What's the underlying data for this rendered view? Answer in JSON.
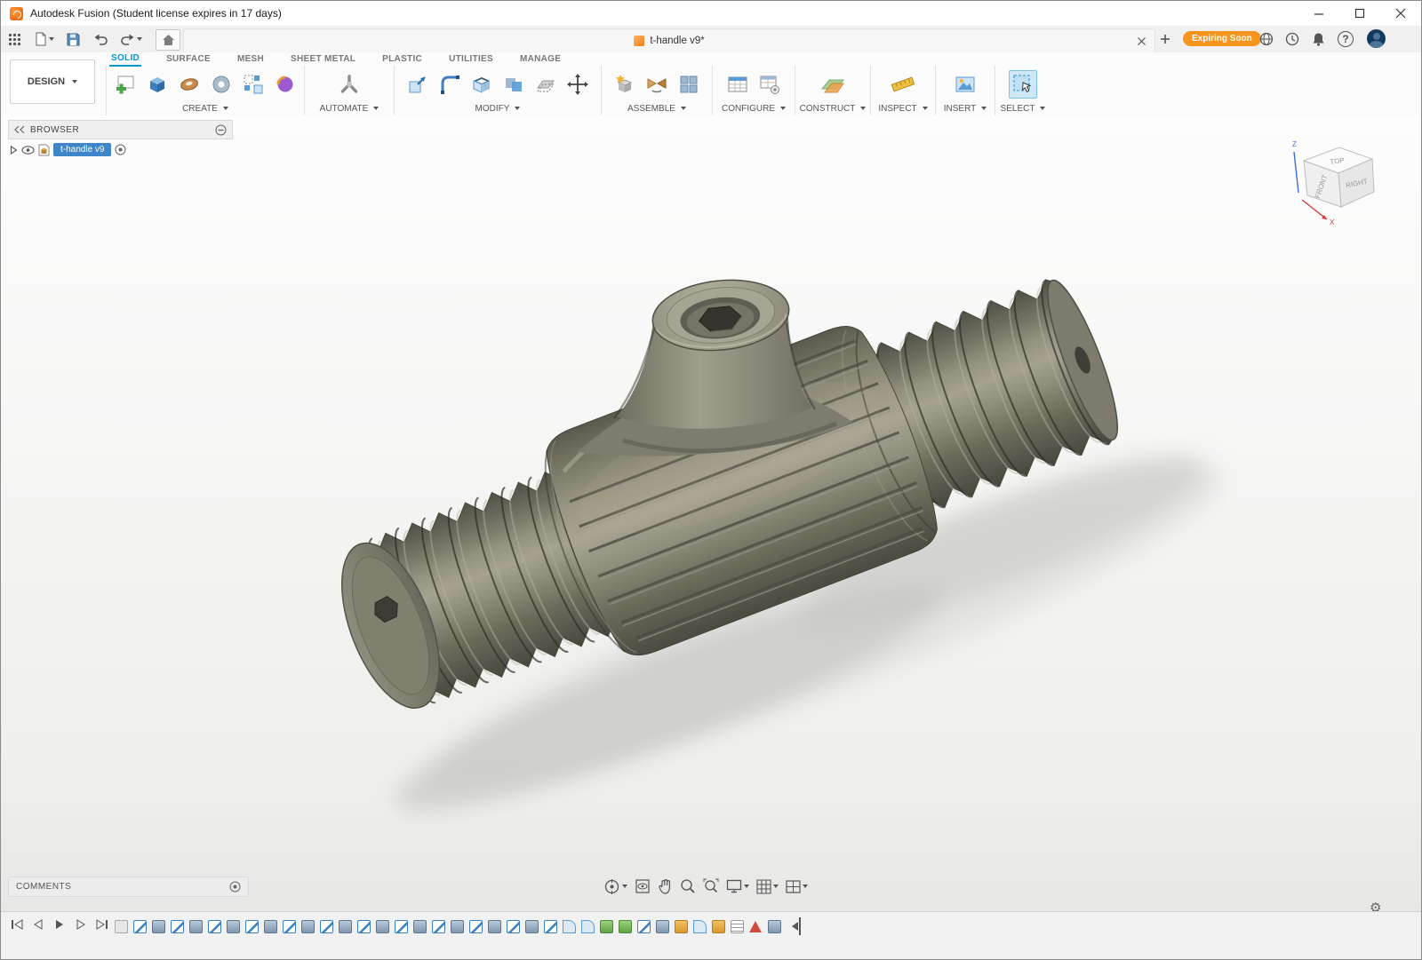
{
  "window": {
    "title": "Autodesk Fusion (Student license expires in 17 days)"
  },
  "tab_bar": {
    "document_title": "t-handle v9*",
    "expiring_badge": "Expiring Soon"
  },
  "ribbon": {
    "workspace": "DESIGN",
    "tabs": [
      {
        "label": "SOLID",
        "active": true
      },
      {
        "label": "SURFACE"
      },
      {
        "label": "MESH"
      },
      {
        "label": "SHEET METAL"
      },
      {
        "label": "PLASTIC"
      },
      {
        "label": "UTILITIES"
      },
      {
        "label": "MANAGE"
      }
    ],
    "groups": [
      {
        "label": "CREATE"
      },
      {
        "label": "AUTOMATE"
      },
      {
        "label": "MODIFY"
      },
      {
        "label": "ASSEMBLE"
      },
      {
        "label": "CONFIGURE"
      },
      {
        "label": "CONSTRUCT"
      },
      {
        "label": "INSPECT"
      },
      {
        "label": "INSERT"
      },
      {
        "label": "SELECT"
      }
    ]
  },
  "browser": {
    "title": "BROWSER",
    "items": [
      {
        "label": "t-handle v9",
        "selected": true
      }
    ]
  },
  "viewcube": {
    "top": "TOP",
    "front": "FRONT",
    "right": "RIGHT",
    "axis_x": "X",
    "axis_z": "Z"
  },
  "comments": {
    "title": "COMMENTS"
  },
  "icons": {
    "help": "?",
    "gear": "⚙"
  },
  "timeline": {
    "features": [
      "folder",
      "sketch",
      "extrude",
      "sketch",
      "extrude",
      "sketch",
      "extrude",
      "sketch",
      "extrude",
      "sketch",
      "extrude",
      "sketch",
      "extrude",
      "sketch",
      "extrude",
      "sketch",
      "extrude",
      "sketch",
      "extrude",
      "sketch",
      "extrude",
      "sketch",
      "extrude",
      "sketch",
      "fillet",
      "fillet",
      "appearance",
      "appearance",
      "sketch",
      "extrude",
      "thread",
      "fillet",
      "thread",
      "list",
      "warning",
      "extrude"
    ]
  },
  "colors": {
    "accent": "#0696d7",
    "selection": "#3f85c9",
    "badge_bg": "#f7941e",
    "model_base": "#7b7a6d"
  }
}
